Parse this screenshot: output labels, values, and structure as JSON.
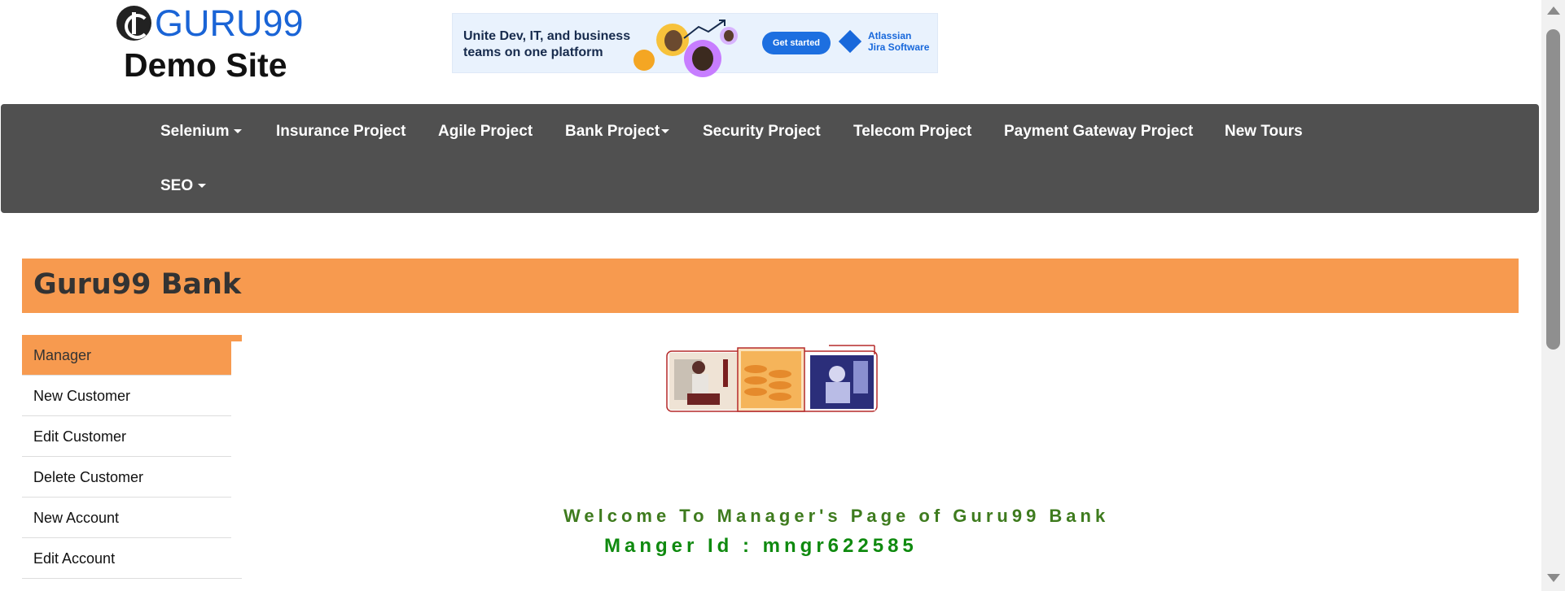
{
  "header": {
    "logo_text": "GURU99",
    "subtitle": "Demo Site"
  },
  "ad": {
    "text_line1": "Unite Dev, IT, and business",
    "text_line2": "teams on one platform",
    "button": "Get started",
    "brand_line1": "Atlassian",
    "brand_line2": "Jira Software"
  },
  "nav": {
    "items": [
      {
        "label": "Selenium",
        "dropdown": true
      },
      {
        "label": "Insurance Project",
        "dropdown": false
      },
      {
        "label": "Agile Project",
        "dropdown": false
      },
      {
        "label": "Bank Project",
        "dropdown": true
      },
      {
        "label": "Security Project",
        "dropdown": false
      },
      {
        "label": "Telecom Project",
        "dropdown": false
      },
      {
        "label": "Payment Gateway Project",
        "dropdown": false
      },
      {
        "label": "New Tours",
        "dropdown": false
      },
      {
        "label": "SEO",
        "dropdown": true
      }
    ]
  },
  "bank": {
    "title": "Guru99 Bank"
  },
  "sidebar": {
    "items": [
      {
        "label": "Manager",
        "active": true
      },
      {
        "label": "New Customer",
        "active": false
      },
      {
        "label": "Edit Customer",
        "active": false
      },
      {
        "label": "Delete Customer",
        "active": false
      },
      {
        "label": "New Account",
        "active": false
      },
      {
        "label": "Edit Account",
        "active": false
      }
    ]
  },
  "main": {
    "welcome": "Welcome To Manager's Page of Guru99 Bank",
    "manager_id": "Manger Id : mngr622585"
  },
  "colors": {
    "nav_bg": "#505050",
    "accent_orange": "#f79a4f",
    "welcome_green": "#3e7b1e",
    "id_green": "#0f8a0f",
    "logo_blue": "#1a64d6"
  }
}
